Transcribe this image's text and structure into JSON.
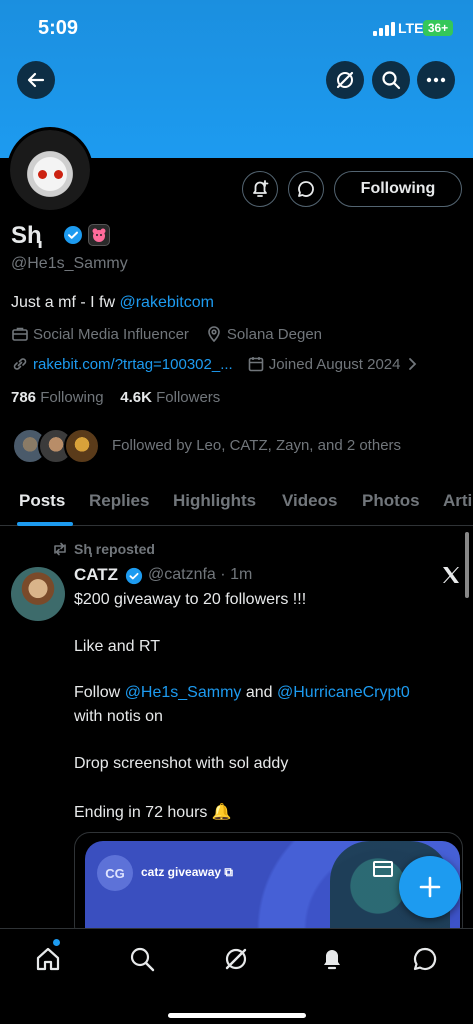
{
  "status_bar": {
    "time": "5:09",
    "network": "LTE",
    "battery": "36+"
  },
  "colors": {
    "accent": "#1d9bf0",
    "banner": "#1d9bf0",
    "battery": "#34c759",
    "background": "#000000"
  },
  "top_actions": {
    "back_icon": "arrow-left-icon",
    "grok_icon": "grok-icon",
    "search_icon": "search-icon",
    "more_icon": "more-horizontal-icon"
  },
  "profile": {
    "name": "Sⱨ",
    "handle": "@He1s_Sammy",
    "bio_text": "Just a mf - I fw ",
    "bio_link": "@rakebitcom",
    "category": "Social Media Influencer",
    "location": "Solana Degen",
    "website": "rakebit.com/?trtag=100302_...",
    "joined": "Joined August 2024",
    "following_count": "786",
    "following_label": "Following",
    "followers_count": "4.6K",
    "followers_label": "Followers",
    "followed_by": "Followed by Leo, CATZ, Zayn, and 2 others",
    "follow_button": "Following"
  },
  "tabs": [
    "Posts",
    "Replies",
    "Highlights",
    "Videos",
    "Photos",
    "Arti"
  ],
  "post": {
    "reposted_label": "Sⱨ reposted",
    "author": "CATZ",
    "author_handle": "@catznfa",
    "dot": "·",
    "time": "1m",
    "line1": "$200 giveaway to 20 followers !!!",
    "line2": "Like and RT",
    "follow_prefix": "Follow ",
    "mention1": "@He1s_Sammy",
    "and_text": " and ",
    "mention2": "@HurricaneCrypt0",
    "line4": "with notis on",
    "line5": "Drop screenshot with sol addy",
    "line6": "Ending in 72 hours 🔔",
    "card_initials": "CG",
    "card_title": "catz giveaway"
  },
  "bottom_nav": [
    "home-icon",
    "search-icon",
    "grok-icon",
    "notifications-icon",
    "messages-icon"
  ]
}
